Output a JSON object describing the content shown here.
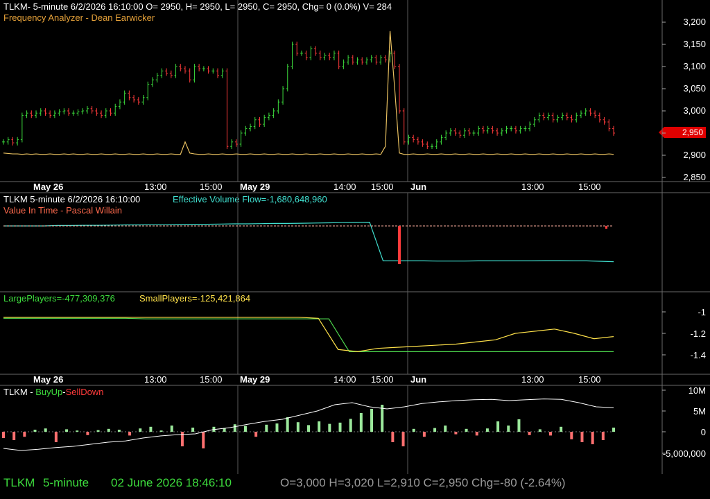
{
  "panel1": {
    "header": "TLKM- 5-minute 6/2/2026 16:10:00 O= 2950, H= 2950, L= 2950, C= 2950, Chg= 0 (0.0%) V= 284",
    "indicator": "Frequency Analyzer - Dean Earwicker",
    "last_price_tag": "2,950",
    "y_ticks": [
      "3,200",
      "3,150",
      "3,100",
      "3,050",
      "3,000",
      "2,950",
      "2,900",
      "2,850"
    ]
  },
  "axis_labels": {
    "dates": [
      "May 26",
      "May 29",
      "Jun"
    ],
    "times": [
      "13:00",
      "15:00",
      "14:00",
      "15:00",
      "13:00",
      "15:00"
    ]
  },
  "panel2": {
    "title": "TLKM 5-minute  6/2/2026 16:10:00",
    "evf_label": "Effective Volume Flow=-1,680,648,960",
    "vit_label": "Value In Time - Pascal Willain"
  },
  "panel3": {
    "large_label": "LargePlayers=-477,309,376",
    "small_label": "SmallPlayers=-125,421,864",
    "y_ticks": [
      "-1",
      "-1.2",
      "-1.4"
    ]
  },
  "panel4": {
    "title_prefix": "TLKM - ",
    "buyup": "BuyUp",
    "dash": "-",
    "selldown": "SellDown",
    "y_ticks": [
      "10M",
      "5M",
      "0",
      "-5,000,000"
    ]
  },
  "footer": {
    "symbol": "TLKM",
    "interval": "5-minute",
    "datetime": "02 June 2026 18:46:10",
    "ohlc": "O=3,000  H=3,020  L=2,910  C=2,950  Chg=-80 (-2.64%)"
  },
  "colors": {
    "up": "#3ddc3d",
    "down": "#ff3b3b",
    "freq": "#e8c060",
    "evf": "#40e0d0",
    "large": "#4cd44c",
    "small": "#ffe24a"
  },
  "chart_data": {
    "type": "line",
    "x_sessions": [
      "May 26",
      "May 29",
      "Jun"
    ],
    "price": {
      "ylim": [
        2840,
        3230
      ],
      "values": [
        2930,
        2935,
        2928,
        2935,
        2990,
        2995,
        2990,
        2995,
        3000,
        2995,
        2990,
        2995,
        2998,
        3000,
        2995,
        2995,
        2998,
        3000,
        3005,
        3000,
        2995,
        2990,
        3000,
        2995,
        3010,
        3020,
        3040,
        3030,
        3025,
        3020,
        3030,
        3060,
        3070,
        3080,
        3090,
        3085,
        3080,
        3100,
        3095,
        3090,
        3070,
        3100,
        3095,
        3095,
        3090,
        3090,
        3080,
        3090,
        2920,
        2930,
        2925,
        2950,
        2960,
        2965,
        2980,
        2970,
        2985,
        2990,
        3000,
        3020,
        3050,
        3100,
        3150,
        3130,
        3130,
        3120,
        3140,
        3130,
        3120,
        3125,
        3120,
        3130,
        3100,
        3110,
        3120,
        3110,
        3115,
        3110,
        3115,
        3120,
        3110,
        3120,
        3115,
        3130,
        3100,
        3000,
        2930,
        2940,
        2935,
        2930,
        2925,
        2920,
        2920,
        2930,
        2940,
        2950,
        2955,
        2950,
        2945,
        2955,
        2950,
        2950,
        2960,
        2955,
        2960,
        2955,
        2950,
        2955,
        2960,
        2960,
        2955,
        2960,
        2960,
        2970,
        2980,
        2990,
        2985,
        2990,
        2980,
        2985,
        2990,
        2985,
        2980,
        2990,
        2995,
        3000,
        2995,
        2990,
        2980,
        2975,
        2960,
        2950
      ],
      "series_colors_by_direction": true
    },
    "frequency_analyzer": {
      "values": [
        2905,
        2904,
        2903,
        2903,
        2902,
        2903,
        2902,
        2903,
        2902,
        2902,
        2903,
        2902,
        2902,
        2903,
        2902,
        2903,
        2902,
        2902,
        2903,
        2902,
        2902,
        2903,
        2902,
        2902,
        2903,
        2902,
        2902,
        2903,
        2902,
        2902,
        2903,
        2902,
        2902,
        2903,
        2902,
        2902,
        2903,
        2902,
        2902,
        2930,
        2905,
        2903,
        2902,
        2902,
        2903,
        2902,
        2902,
        2903,
        2902,
        2902,
        2903,
        2902,
        2902,
        2903,
        2902,
        2902,
        2903,
        2902,
        2902,
        2903,
        2902,
        2902,
        2903,
        2902,
        2902,
        2903,
        2902,
        2902,
        2903,
        2902,
        2902,
        2903,
        2902,
        2902,
        2903,
        2902,
        2902,
        2903,
        2902,
        2902,
        2903,
        2902,
        2920,
        3180,
        3050,
        2905,
        2902,
        2902,
        2903,
        2902,
        2902,
        2903,
        2902,
        2902,
        2903,
        2902,
        2902,
        2903,
        2902,
        2902,
        2903,
        2902,
        2902,
        2903,
        2902,
        2902,
        2903,
        2902,
        2902,
        2903,
        2902,
        2902,
        2903,
        2902,
        2902,
        2903,
        2902,
        2902,
        2903,
        2902,
        2902,
        2903,
        2902,
        2902,
        2903,
        2902,
        2902,
        2903,
        2902,
        2902,
        2903,
        2902
      ]
    },
    "effective_volume_flow": {
      "values": [
        0,
        0,
        0,
        0,
        0.02,
        0.02,
        0.03,
        0.03,
        0.04,
        0.05,
        0.05,
        0.06,
        0.06,
        0.07,
        0.08,
        0.08,
        0.09,
        0.1,
        0.1,
        0.11,
        0.12,
        0.12,
        0.13,
        0.14,
        0.15,
        0.16,
        0.17,
        0.18,
        -1.68,
        -1.68,
        -1.68,
        -1.68,
        -1.69,
        -1.69,
        -1.69,
        -1.68,
        -1.68,
        -1.68,
        -1.68,
        -1.68,
        -1.67,
        -1.67,
        -1.68,
        -1.68,
        -1.7,
        -1.72
      ]
    },
    "large_players": {
      "ylim": [
        -1.5,
        -0.9
      ],
      "values": [
        -1.06,
        -1.06,
        -1.06,
        -1.06,
        -1.06,
        -1.06,
        -1.06,
        -1.065,
        -1.065,
        -1.065,
        -1.065,
        -1.065,
        -1.065,
        -1.065,
        -1.065,
        -1.065,
        -1.065,
        -1.37,
        -1.37,
        -1.37,
        -1.37,
        -1.37,
        -1.37,
        -1.37,
        -1.37,
        -1.37,
        -1.37,
        -1.37,
        -1.37,
        -1.37,
        -1.37
      ]
    },
    "small_players": {
      "values": [
        -1.05,
        -1.05,
        -1.05,
        -1.05,
        -1.05,
        -1.05,
        -1.05,
        -1.05,
        -1.05,
        -1.05,
        -1.05,
        -1.05,
        -1.05,
        -1.05,
        -1.05,
        -1.05,
        -1.06,
        -1.35,
        -1.37,
        -1.34,
        -1.33,
        -1.32,
        -1.31,
        -1.3,
        -1.28,
        -1.26,
        -1.2,
        -1.18,
        -1.16,
        -1.2,
        -1.25,
        -1.23
      ]
    },
    "buyup_selldown": {
      "ylim": [
        -6500000,
        11000000
      ],
      "values": [
        -1500000,
        -2000000,
        -1200000,
        500000,
        800000,
        -2500000,
        600000,
        300000,
        -800000,
        400000,
        700000,
        500000,
        -900000,
        800000,
        1200000,
        300000,
        1500000,
        -3500000,
        1000000,
        -4000000,
        1200000,
        900000,
        1800000,
        1400000,
        -1200000,
        1700000,
        2000000,
        3500000,
        2300000,
        1600000,
        2500000,
        1900000,
        2200000,
        3100000,
        4500000,
        5500000,
        6500000,
        -2500000,
        -3500000,
        700000,
        -1200000,
        900000,
        1500000,
        -600000,
        700000,
        -900000,
        800000,
        2500000,
        1500000,
        3000000,
        -800000,
        600000,
        -900000,
        1200000,
        -1800000,
        -2500000,
        -3000000,
        -2000000,
        1000000
      ],
      "line_values": [
        -4000000,
        -4500000,
        -4200000,
        -3800000,
        -3500000,
        -3000000,
        -2500000,
        -2200000,
        -1500000,
        -1000000,
        -700000,
        -500000,
        500000,
        1000000,
        1800000,
        2500000,
        3000000,
        4000000,
        5000000,
        6500000,
        7000000,
        6000000,
        5500000,
        6000000,
        6800000,
        7200000,
        7500000,
        7700000,
        7800000,
        7500000,
        7700000,
        7900000,
        7800000,
        7000000,
        6000000,
        5800000
      ]
    }
  }
}
